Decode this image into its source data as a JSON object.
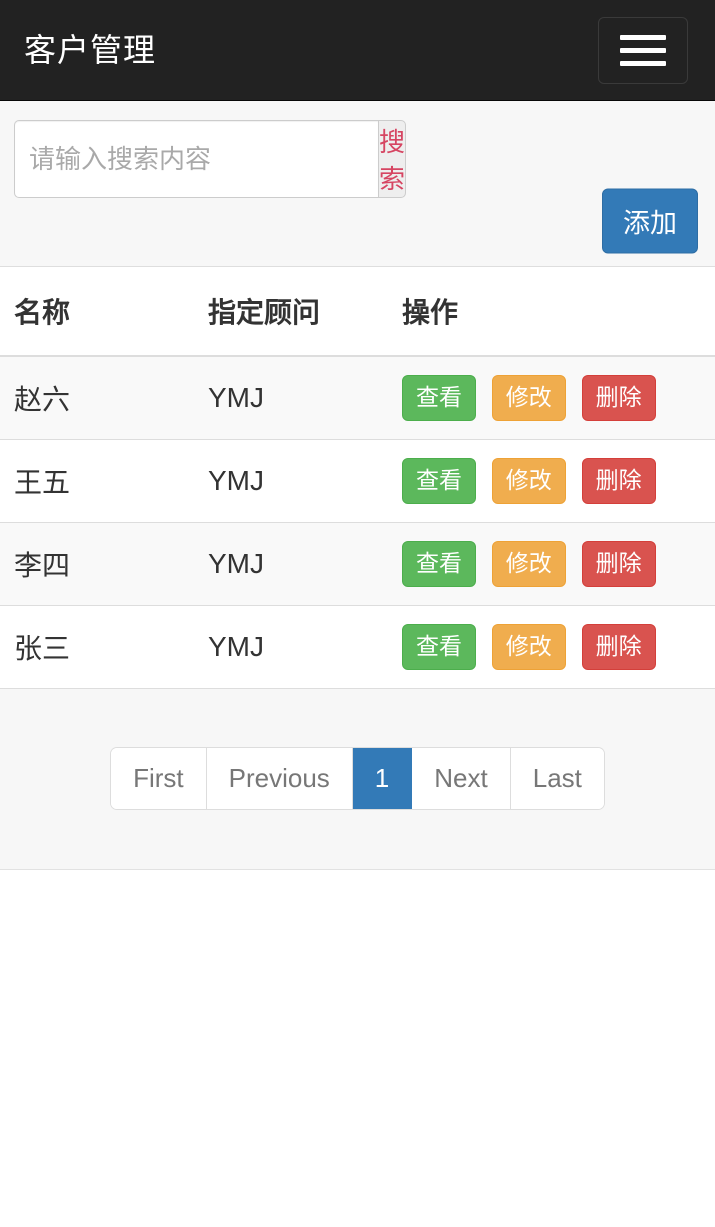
{
  "navbar": {
    "title": "客户管理",
    "menu_icon": "hamburger-menu-icon"
  },
  "search": {
    "placeholder": "请输入搜索内容",
    "value": "",
    "search_label": "搜索",
    "add_label": "添加"
  },
  "table": {
    "headers": [
      "名称",
      "指定顾问",
      "操作"
    ],
    "rows": [
      {
        "name": "赵六",
        "adviser": "YMJ"
      },
      {
        "name": "王五",
        "adviser": "YMJ"
      },
      {
        "name": "李四",
        "adviser": "YMJ"
      },
      {
        "name": "张三",
        "adviser": "YMJ"
      }
    ],
    "actions": {
      "view": "查看",
      "edit": "修改",
      "delete": "删除"
    }
  },
  "pagination": {
    "first": "First",
    "previous": "Previous",
    "current": "1",
    "next": "Next",
    "last": "Last"
  },
  "colors": {
    "navbar_bg": "#222222",
    "primary": "#337ab7",
    "success": "#5cb85c",
    "warning": "#f0ad4e",
    "danger": "#d9534f",
    "search_link": "#d64562",
    "panel_bg": "#f7f7f7"
  }
}
